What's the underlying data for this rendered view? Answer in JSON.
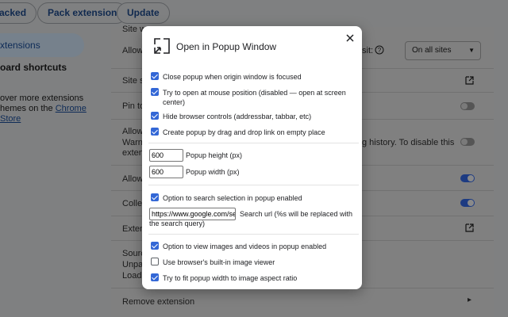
{
  "toolbar": {
    "load_unpacked": "acked",
    "pack_extension": "Pack extension",
    "update": "Update"
  },
  "sidebar": {
    "extensions": "xtensions",
    "keyboard_shortcuts": "oard shortcuts",
    "discover_line1": "over more extensions",
    "discover_line2": "hemes on the ",
    "discover_link": "Chrome",
    "discover_line3": "Store"
  },
  "details": {
    "site_access": "Site w",
    "allow_label": "Allow",
    "site_access_suffix": "sit:",
    "site_select": "On all sites",
    "site_settings": "Site se",
    "pin": "Pin to",
    "allow_incognito": "Allow",
    "warning_line1": "Warnin",
    "warning_line2": "extens",
    "warning_tail_line1": "g history. To disable this",
    "warning_tail_line2": "exten",
    "allow_file_urls": "Allow",
    "collect_errors": "Collec",
    "extension_options": "Extens",
    "source_label": "Sourc",
    "source_unpacked": "Unpac",
    "source_loaded": "Loade",
    "remove_extension": "Remove extension"
  },
  "dialog": {
    "title": "Open in Popup Window",
    "icon": "popup-window-logo-icon",
    "close_icon": "close-icon",
    "options_1": [
      {
        "label": "Close popup when origin window is focused",
        "checked": true
      },
      {
        "label": "Try to open at mouse position (disabled — open at screen center)",
        "checked": true
      },
      {
        "label": "Hide browser controls (addressbar, tabbar, etc)",
        "checked": true
      },
      {
        "label": "Create popup by drag and drop link on empty place",
        "checked": true
      }
    ],
    "popup_height": {
      "value": "600",
      "label": "Popup height (px)"
    },
    "popup_width": {
      "value": "600",
      "label": "Popup width (px)"
    },
    "search_option": {
      "label": "Option to search selection in popup enabled",
      "checked": true
    },
    "search_url": {
      "value": "https://www.google.com/search?q=%s",
      "label": "Search url (%s will be replaced with the search query)"
    },
    "options_2": [
      {
        "label": "Option to view images and videos in popup enabled",
        "checked": true
      },
      {
        "label": "Use browser's built-in image viewer",
        "checked": false
      },
      {
        "label": "Try to fit popup width to image aspect ratio",
        "checked": true
      }
    ]
  },
  "colors": {
    "accent": "#3367d6",
    "overlay": "#7f8081",
    "dialog_bg": "#ffffff"
  }
}
